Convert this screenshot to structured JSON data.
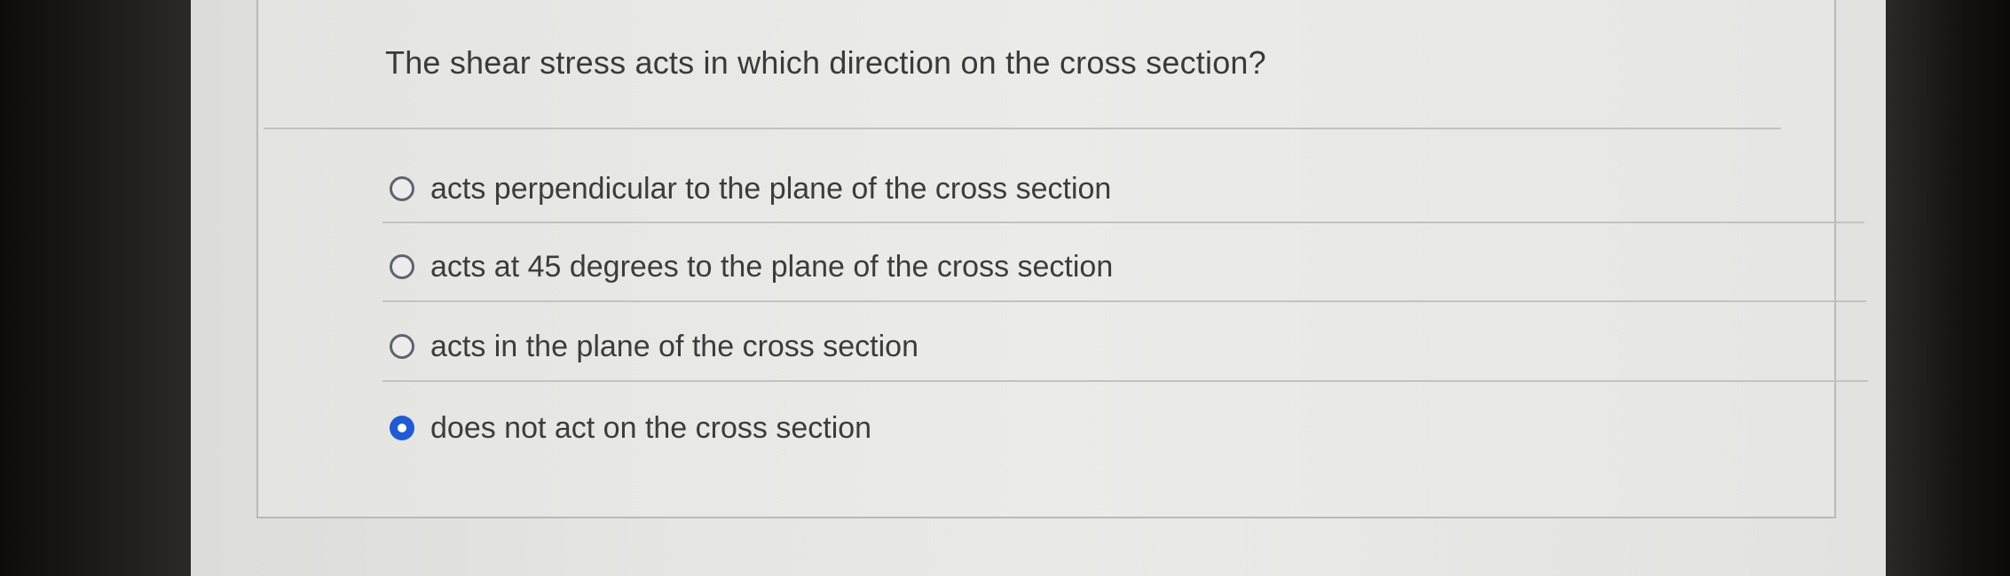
{
  "question": {
    "text": "The shear stress acts in which direction on the cross section?"
  },
  "answers": [
    {
      "label": "acts perpendicular to the plane of the cross section",
      "selected": false
    },
    {
      "label": "acts at 45 degrees to the plane of the cross section",
      "selected": false
    },
    {
      "label": "acts in the plane of the cross section",
      "selected": false
    },
    {
      "label": "does not act on the cross section",
      "selected": true
    }
  ],
  "colors": {
    "selected_radio": "#1e5bd6",
    "text": "#3a3a3a"
  }
}
